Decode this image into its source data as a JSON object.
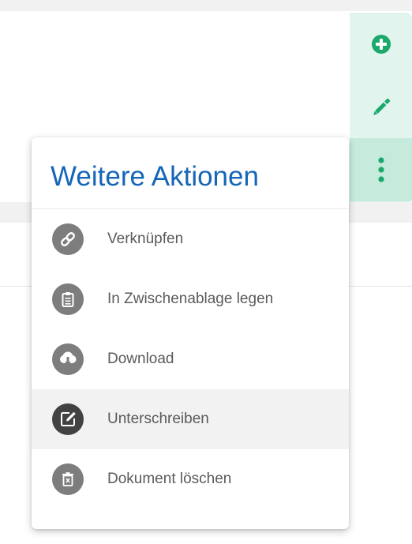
{
  "toolbar": {
    "add_icon": "plus-circle-icon",
    "edit_icon": "pencil-icon",
    "more_icon": "more-vertical-icon",
    "accent_color": "#1aa86b"
  },
  "menu": {
    "title": "Weitere Aktionen",
    "title_color": "#1565b8",
    "items": [
      {
        "label": "Verknüpfen",
        "icon": "link-icon"
      },
      {
        "label": "In Zwischenablage legen",
        "icon": "clipboard-icon"
      },
      {
        "label": "Download",
        "icon": "cloud-download-icon"
      },
      {
        "label": "Unterschreiben",
        "icon": "sign-icon",
        "highlighted": true
      },
      {
        "label": "Dokument löschen",
        "icon": "trash-icon"
      }
    ]
  }
}
